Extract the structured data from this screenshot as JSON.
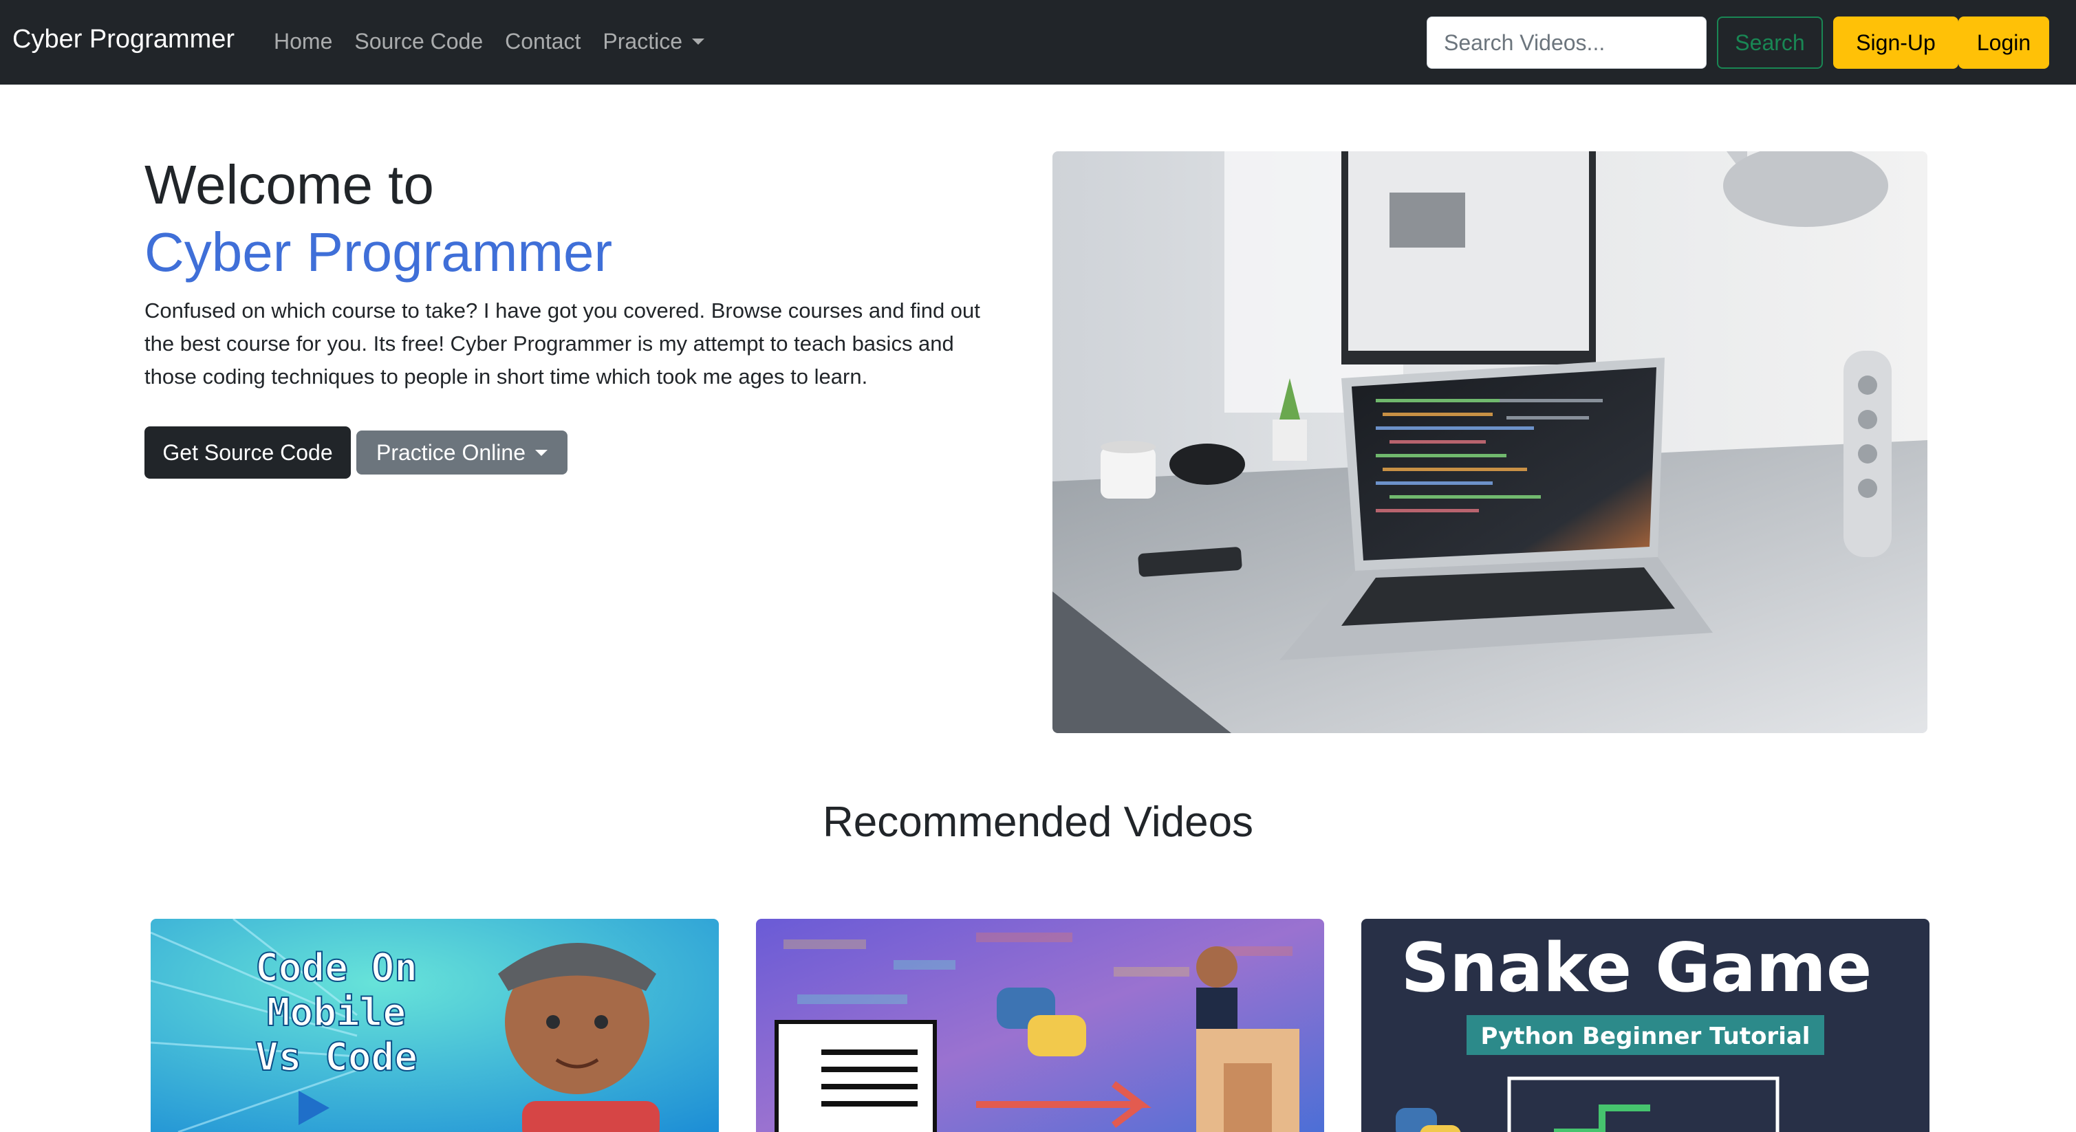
{
  "navbar": {
    "brand": "Cyber Programmer",
    "links": [
      {
        "label": "Home"
      },
      {
        "label": "Source Code"
      },
      {
        "label": "Contact"
      },
      {
        "label": "Practice"
      }
    ],
    "search": {
      "placeholder": "Search Videos...",
      "value": ""
    },
    "search_button": "Search",
    "signup_button": "Sign-Up",
    "login_button": "Login"
  },
  "hero": {
    "title_line1": "Welcome to",
    "title_line2": "Cyber Programmer",
    "description": "Confused on which course to take? I have got you covered. Browse courses and find out the best course for you. Its free! Cyber Programmer is my attempt to teach basics and those coding techniques to people in short time which took me ages to learn.",
    "source_button": "Get Source Code",
    "practice_button": "Practice Online"
  },
  "recommended": {
    "title": "Recommended Videos",
    "videos": [
      {
        "thumb_text_1": "Code On",
        "thumb_text_2": "Mobile",
        "thumb_text_3": "Vs Code"
      },
      {},
      {
        "thumb_title": "Snake Game",
        "thumb_subtitle": "Python Beginner Tutorial"
      }
    ]
  },
  "colors": {
    "navbar": "#212529",
    "accent": "#3f6fd8",
    "warning": "#ffc107",
    "success": "#198754",
    "secondary": "#6c757d"
  }
}
